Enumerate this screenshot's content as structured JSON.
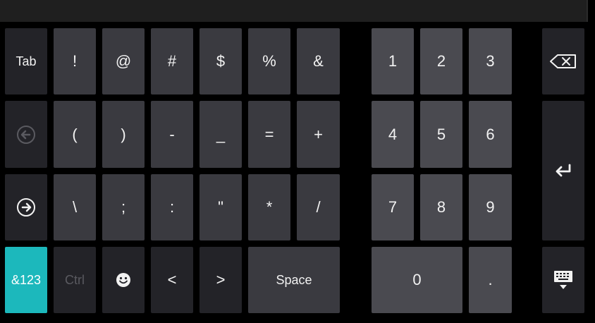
{
  "keyboard": {
    "row1": [
      "Tab",
      "!",
      "@",
      "#",
      "$",
      "%",
      "&"
    ],
    "row2": [
      "(",
      ")",
      "-",
      "_",
      "=",
      "+"
    ],
    "row3": [
      "\\",
      ";",
      ":",
      "\"",
      "*",
      "/"
    ],
    "row4": {
      "mode": "&123",
      "ctrl": "Ctrl",
      "less": "<",
      "greater": ">",
      "space": "Space"
    },
    "numpad": [
      "1",
      "2",
      "3",
      "4",
      "5",
      "6",
      "7",
      "8",
      "9",
      "0",
      "."
    ],
    "icons": {
      "backspace": "backspace-icon",
      "enter": "enter-icon",
      "prev": "circle-left-arrow-icon",
      "next": "circle-right-arrow-icon",
      "emoji": "smiley-icon",
      "hide": "keyboard-hide-icon"
    },
    "colors": {
      "active": "#1cb8bc",
      "key": "#3a3a40",
      "numkey": "#4a4a50",
      "functionkey": "#232328",
      "background": "#000000"
    }
  }
}
